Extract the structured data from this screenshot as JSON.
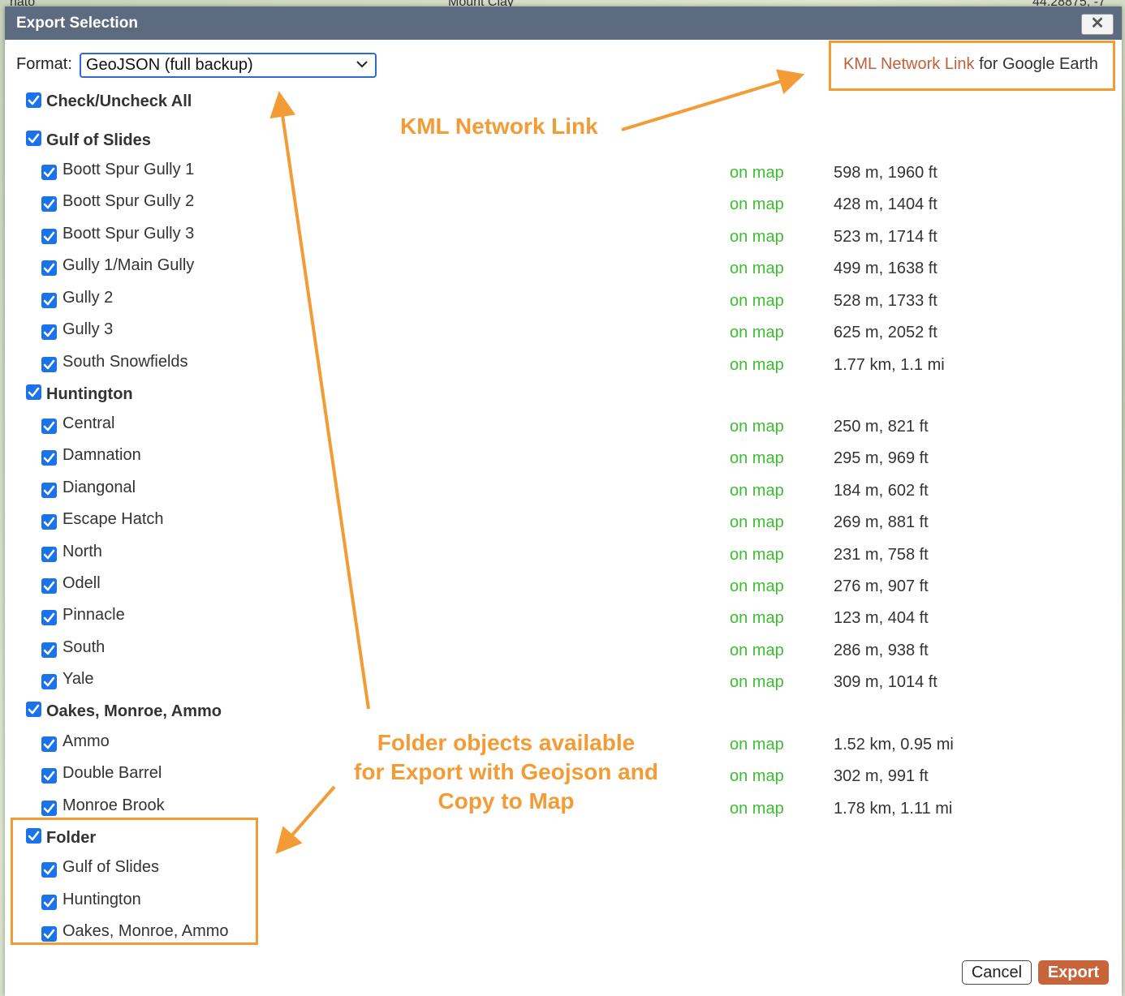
{
  "map": {
    "label_left": "nato",
    "label_mid": "Mount Clay",
    "label_right": "44.28875, -7"
  },
  "dialog": {
    "title": "Export Selection",
    "close_label": "✕",
    "format_label": "Format:",
    "format_value": "GeoJSON (full backup)",
    "kml_link_text": "KML Network Link",
    "kml_link_suffix": " for Google Earth",
    "check_all_label": "Check/Uncheck All",
    "groups": [
      {
        "label": "Gulf of Slides",
        "items": [
          {
            "label": "Boott Spur Gully 1",
            "status": "on map",
            "length": "598 m, 1960 ft"
          },
          {
            "label": "Boott Spur Gully 2",
            "status": "on map",
            "length": "428 m, 1404 ft"
          },
          {
            "label": "Boott Spur Gully 3",
            "status": "on map",
            "length": "523 m, 1714 ft"
          },
          {
            "label": "Gully 1/Main Gully",
            "status": "on map",
            "length": "499 m, 1638 ft"
          },
          {
            "label": "Gully 2",
            "status": "on map",
            "length": "528 m, 1733 ft"
          },
          {
            "label": "Gully 3",
            "status": "on map",
            "length": "625 m, 2052 ft"
          },
          {
            "label": "South Snowfields",
            "status": "on map",
            "length": "1.77 km, 1.1 mi"
          }
        ]
      },
      {
        "label": "Huntington",
        "items": [
          {
            "label": "Central",
            "status": "on map",
            "length": "250 m, 821 ft"
          },
          {
            "label": "Damnation",
            "status": "on map",
            "length": "295 m, 969 ft"
          },
          {
            "label": "Diangonal",
            "status": "on map",
            "length": "184 m, 602 ft"
          },
          {
            "label": "Escape Hatch",
            "status": "on map",
            "length": "269 m, 881 ft"
          },
          {
            "label": "North",
            "status": "on map",
            "length": "231 m, 758 ft"
          },
          {
            "label": "Odell",
            "status": "on map",
            "length": "276 m, 907 ft"
          },
          {
            "label": "Pinnacle",
            "status": "on map",
            "length": "123 m, 404 ft"
          },
          {
            "label": "South",
            "status": "on map",
            "length": "286 m, 938 ft"
          },
          {
            "label": "Yale",
            "status": "on map",
            "length": "309 m, 1014 ft"
          }
        ]
      },
      {
        "label": "Oakes, Monroe, Ammo",
        "items": [
          {
            "label": "Ammo",
            "status": "on map",
            "length": "1.52 km, 0.95 mi"
          },
          {
            "label": "Double Barrel",
            "status": "on map",
            "length": "302 m, 991 ft"
          },
          {
            "label": "Monroe Brook",
            "status": "on map",
            "length": "1.78 km, 1.11 mi"
          }
        ]
      },
      {
        "label": "Folder",
        "items": [
          {
            "label": "Gulf of Slides"
          },
          {
            "label": "Huntington"
          },
          {
            "label": "Oakes, Monroe, Ammo"
          }
        ]
      }
    ],
    "cancel_label": "Cancel",
    "export_label": "Export"
  },
  "annotations": {
    "kml": "KML Network Link",
    "folder_line1": "Folder objects available",
    "folder_line2": "for Export with Geojson and",
    "folder_line3": "Copy to Map"
  },
  "colors": {
    "accent_orange": "#f39b35",
    "export_button": "#c8643a",
    "on_map_green": "#3cbf2f",
    "checkbox_blue": "#1a73e8",
    "titlebar": "#5d6b80"
  }
}
